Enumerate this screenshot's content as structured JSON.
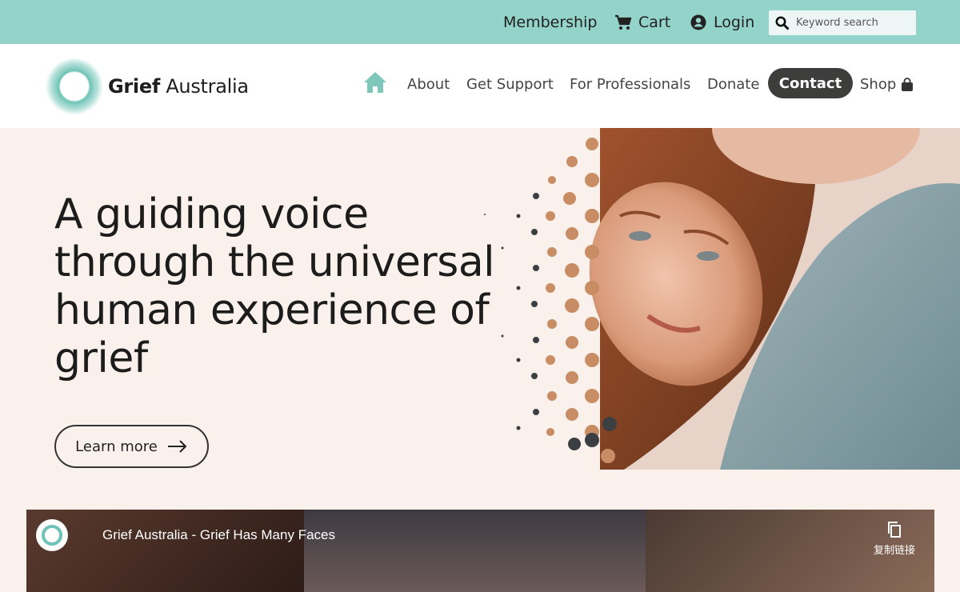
{
  "topbar": {
    "membership": "Membership",
    "cart": "Cart",
    "login": "Login",
    "search_placeholder": "Keyword search",
    "icons": {
      "cart": "cart-icon",
      "login": "user-circle-icon",
      "search": "search-icon"
    }
  },
  "header": {
    "logo_bold": "Grief",
    "logo_rest": " Australia",
    "nav": [
      "About",
      "Get Support",
      "For Professionals",
      "Donate"
    ],
    "contact": "Contact",
    "shop": "Shop",
    "icons": {
      "home": "home-icon",
      "shop": "shopping-bag-icon"
    }
  },
  "hero": {
    "headline": "A guiding voice through the universal human experience of grief",
    "cta": "Learn more"
  },
  "video": {
    "title": "Grief Australia - Grief Has Many Faces",
    "copy_link": "复制链接"
  },
  "colors": {
    "topbar": "#94d3c9",
    "accent": "#94d3c9",
    "hero_bg": "#fbf1ec",
    "contact_btn": "#3d3d3b"
  }
}
